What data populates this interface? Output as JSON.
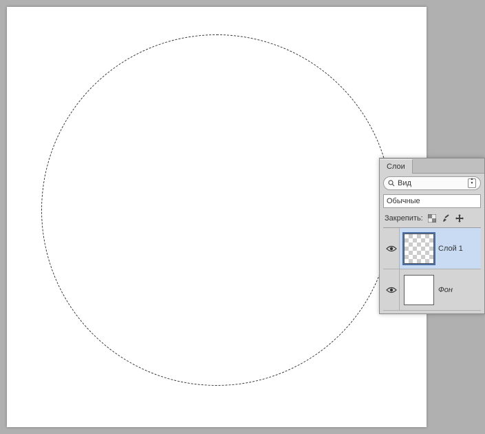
{
  "panel": {
    "tab_label": "Слои",
    "filter_label": "Вид",
    "blend_mode": "Обычные",
    "lock_label": "Закрепить:"
  },
  "layers": {
    "items": [
      {
        "name": "Слой 1"
      },
      {
        "name": "Фон"
      }
    ]
  }
}
